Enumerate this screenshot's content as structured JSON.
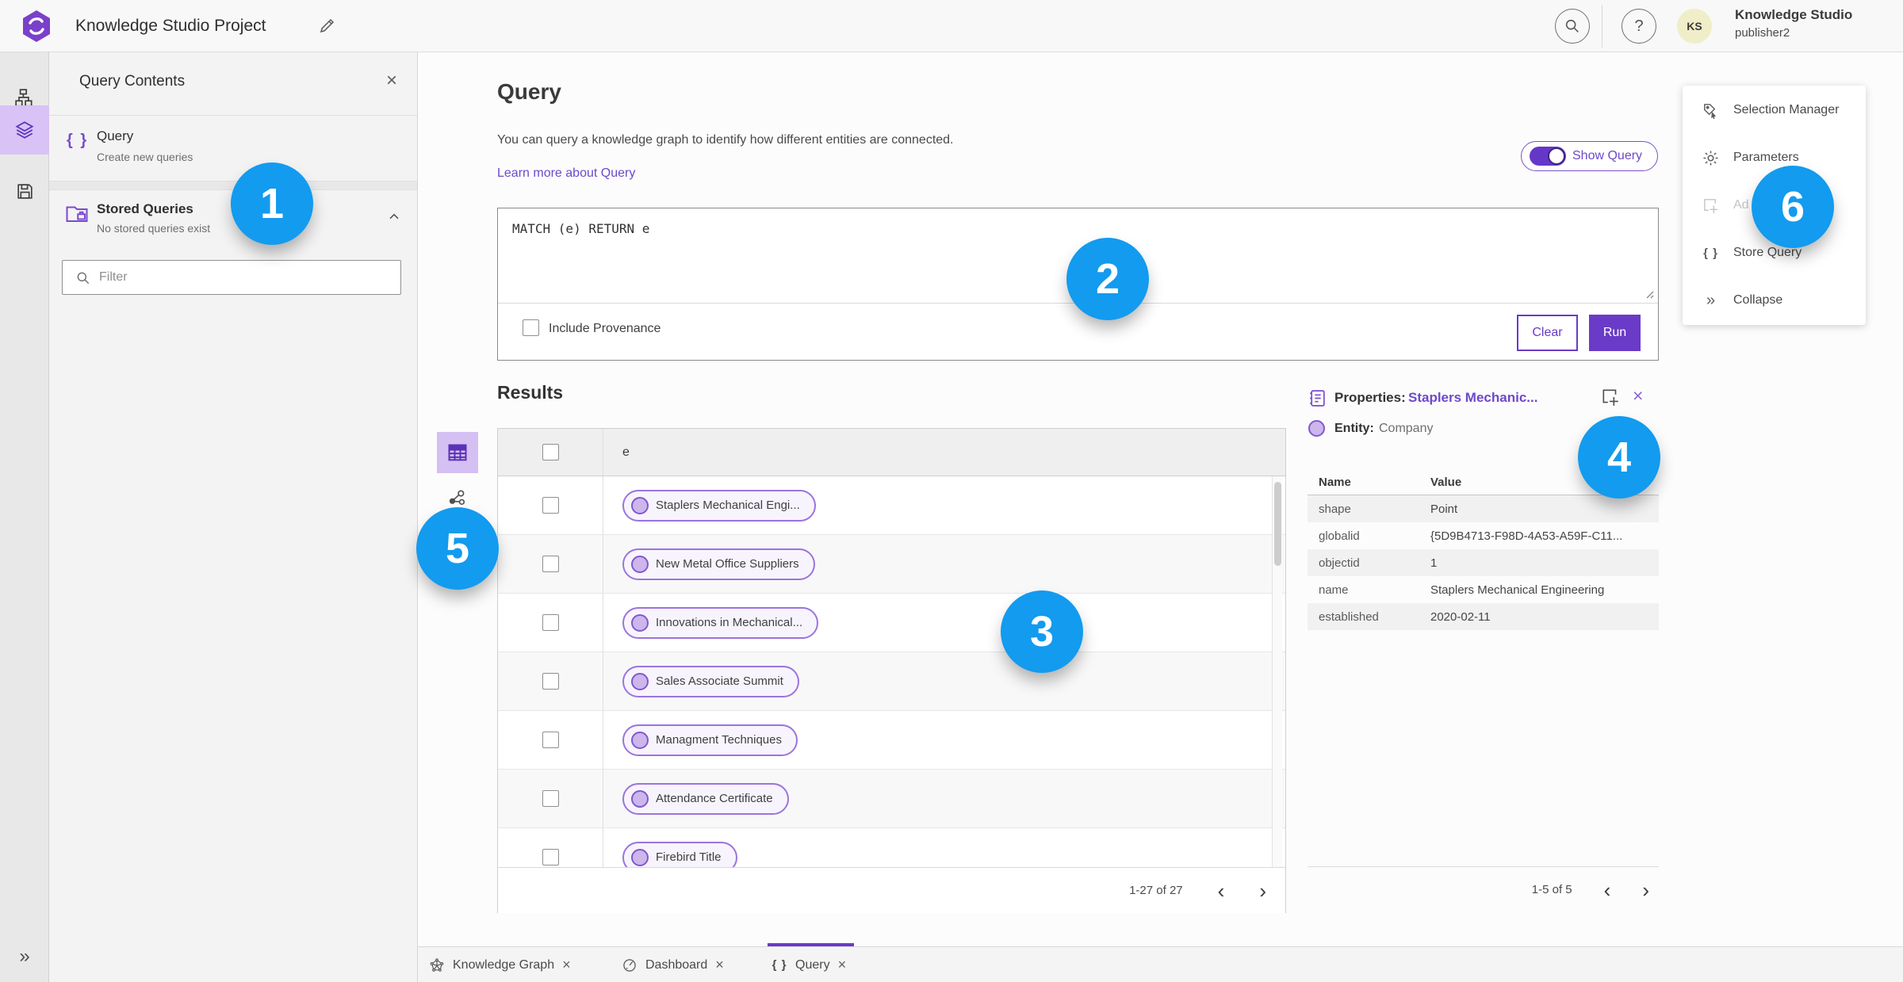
{
  "topbar": {
    "title": "Knowledge Studio Project",
    "user": {
      "initials": "KS",
      "name": "Knowledge Studio",
      "role": "publisher2"
    }
  },
  "contents_panel": {
    "title": "Query Contents",
    "query_item": {
      "icon": "{ }",
      "title": "Query",
      "subtitle": "Create new queries"
    },
    "stored_queries": {
      "title": "Stored Queries",
      "subtitle": "No stored queries exist"
    },
    "filter_placeholder": "Filter"
  },
  "query_section": {
    "heading": "Query",
    "description": "You can query a knowledge graph to identify how different entities are connected.",
    "learn_more": "Learn more about Query",
    "show_query": "Show Query",
    "query_text": "MATCH (e) RETURN e",
    "include_provenance": "Include Provenance",
    "clear": "Clear",
    "run": "Run"
  },
  "results": {
    "heading": "Results",
    "column_header": "e",
    "rows": [
      "Staplers Mechanical Engi...",
      "New Metal Office Suppliers",
      "Innovations in Mechanical...",
      "Sales Associate Summit",
      "Managment Techniques",
      "Attendance Certificate",
      "Firebird Title"
    ],
    "pagination": "1-27 of 27"
  },
  "properties_panel": {
    "label": "Properties:",
    "entity_name": "Staplers Mechanic...",
    "entity_label": "Entity:",
    "entity_type": "Company",
    "col_name": "Name",
    "col_value": "Value",
    "rows": [
      {
        "name": "shape",
        "value": "Point"
      },
      {
        "name": "globalid",
        "value": "{5D9B4713-F98D-4A53-A59F-C11..."
      },
      {
        "name": "objectid",
        "value": "1"
      },
      {
        "name": "name",
        "value": "Staplers Mechanical Engineering"
      },
      {
        "name": "established",
        "value": "2020-02-11"
      }
    ],
    "pagination": "1-5 of 5"
  },
  "tools_menu": {
    "items": [
      {
        "label": "Selection Manager"
      },
      {
        "label": "Parameters"
      },
      {
        "label": "Ad"
      },
      {
        "label": "Store Query"
      },
      {
        "label": "Collapse"
      }
    ]
  },
  "bottom_tabs": {
    "tabs": [
      {
        "label": "Knowledge Graph"
      },
      {
        "label": "Dashboard"
      },
      {
        "label": "Query"
      }
    ]
  },
  "callouts": [
    "1",
    "2",
    "3",
    "4",
    "5",
    "6"
  ],
  "icons": {
    "close": "×",
    "chevron_left": "‹",
    "chevron_right": "›",
    "braces": "{ }",
    "double_chevron": "»",
    "help": "?"
  },
  "colors": {
    "accent_purple": "#6a3ac8",
    "link_purple": "#6d49cb",
    "callout_blue": "#129bef"
  }
}
